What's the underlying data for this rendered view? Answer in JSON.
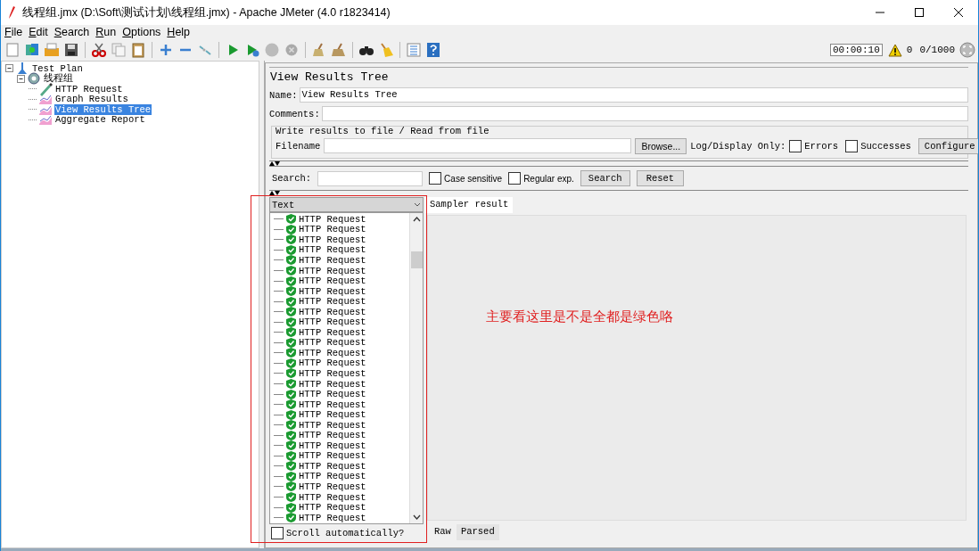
{
  "window": {
    "title": "线程组.jmx (D:\\Soft\\测试计划\\线程组.jmx) - Apache JMeter (4.0 r1823414)"
  },
  "menu": [
    {
      "label": "File"
    },
    {
      "label": "Edit"
    },
    {
      "label": "Search"
    },
    {
      "label": "Run"
    },
    {
      "label": "Options"
    },
    {
      "label": "Help"
    }
  ],
  "status": {
    "timer": "00:00:10",
    "warnings": "0",
    "threads": "0/1000"
  },
  "tree": [
    {
      "label": "Test Plan",
      "kind": "plan",
      "expanded": true,
      "selected": false,
      "children": [
        {
          "label": "线程组",
          "kind": "thread-group",
          "expanded": true,
          "selected": false,
          "children": [
            {
              "label": "HTTP Request",
              "kind": "sampler",
              "selected": false
            },
            {
              "label": "Graph Results",
              "kind": "listener",
              "selected": false
            },
            {
              "label": "View Results Tree",
              "kind": "listener",
              "selected": true
            },
            {
              "label": "Aggregate Report",
              "kind": "listener",
              "selected": false
            }
          ]
        }
      ]
    }
  ],
  "panel": {
    "title": "View Results Tree",
    "name_label": "Name:",
    "name": "View Results Tree",
    "comments_label": "Comments:",
    "file_group": "Write results to file / Read from file",
    "filename_label": "Filename",
    "browse": "Browse...",
    "log_label": "Log/Display Only:",
    "errors": {
      "label": "Errors",
      "checked": false
    },
    "successes": {
      "label": "Successes",
      "checked": false
    },
    "configure": "Configure",
    "search_label": "Search:",
    "case_sensitive": {
      "label": "Case sensitive",
      "checked": false
    },
    "regular_exp": {
      "label": "Regular exp.",
      "checked": false
    },
    "search_button": "Search",
    "reset_button": "Reset",
    "renderer": "Text",
    "results": [
      {
        "label": "HTTP Request",
        "success": true
      },
      {
        "label": "HTTP Request",
        "success": true
      },
      {
        "label": "HTTP Request",
        "success": true
      },
      {
        "label": "HTTP Request",
        "success": true
      },
      {
        "label": "HTTP Request",
        "success": true
      },
      {
        "label": "HTTP Request",
        "success": true
      },
      {
        "label": "HTTP Request",
        "success": true
      },
      {
        "label": "HTTP Request",
        "success": true
      },
      {
        "label": "HTTP Request",
        "success": true
      },
      {
        "label": "HTTP Request",
        "success": true
      },
      {
        "label": "HTTP Request",
        "success": true
      },
      {
        "label": "HTTP Request",
        "success": true
      },
      {
        "label": "HTTP Request",
        "success": true
      },
      {
        "label": "HTTP Request",
        "success": true
      },
      {
        "label": "HTTP Request",
        "success": true
      },
      {
        "label": "HTTP Request",
        "success": true
      },
      {
        "label": "HTTP Request",
        "success": true
      },
      {
        "label": "HTTP Request",
        "success": true
      },
      {
        "label": "HTTP Request",
        "success": true
      },
      {
        "label": "HTTP Request",
        "success": true
      },
      {
        "label": "HTTP Request",
        "success": true
      },
      {
        "label": "HTTP Request",
        "success": true
      },
      {
        "label": "HTTP Request",
        "success": true
      },
      {
        "label": "HTTP Request",
        "success": true
      },
      {
        "label": "HTTP Request",
        "success": true
      },
      {
        "label": "HTTP Request",
        "success": true
      },
      {
        "label": "HTTP Request",
        "success": true
      },
      {
        "label": "HTTP Request",
        "success": true
      },
      {
        "label": "HTTP Request",
        "success": true
      },
      {
        "label": "HTTP Request",
        "success": true
      }
    ],
    "scroll_auto": {
      "label": "Scroll automatically?",
      "checked": false
    },
    "tabs": [
      {
        "label": "Sampler result",
        "selected": true
      }
    ],
    "bottom_tabs": [
      {
        "label": "Raw",
        "selected": true
      },
      {
        "label": "Parsed",
        "selected": false
      }
    ]
  },
  "annotation": {
    "text": "主要看这里是不是全都是绿色咯"
  }
}
